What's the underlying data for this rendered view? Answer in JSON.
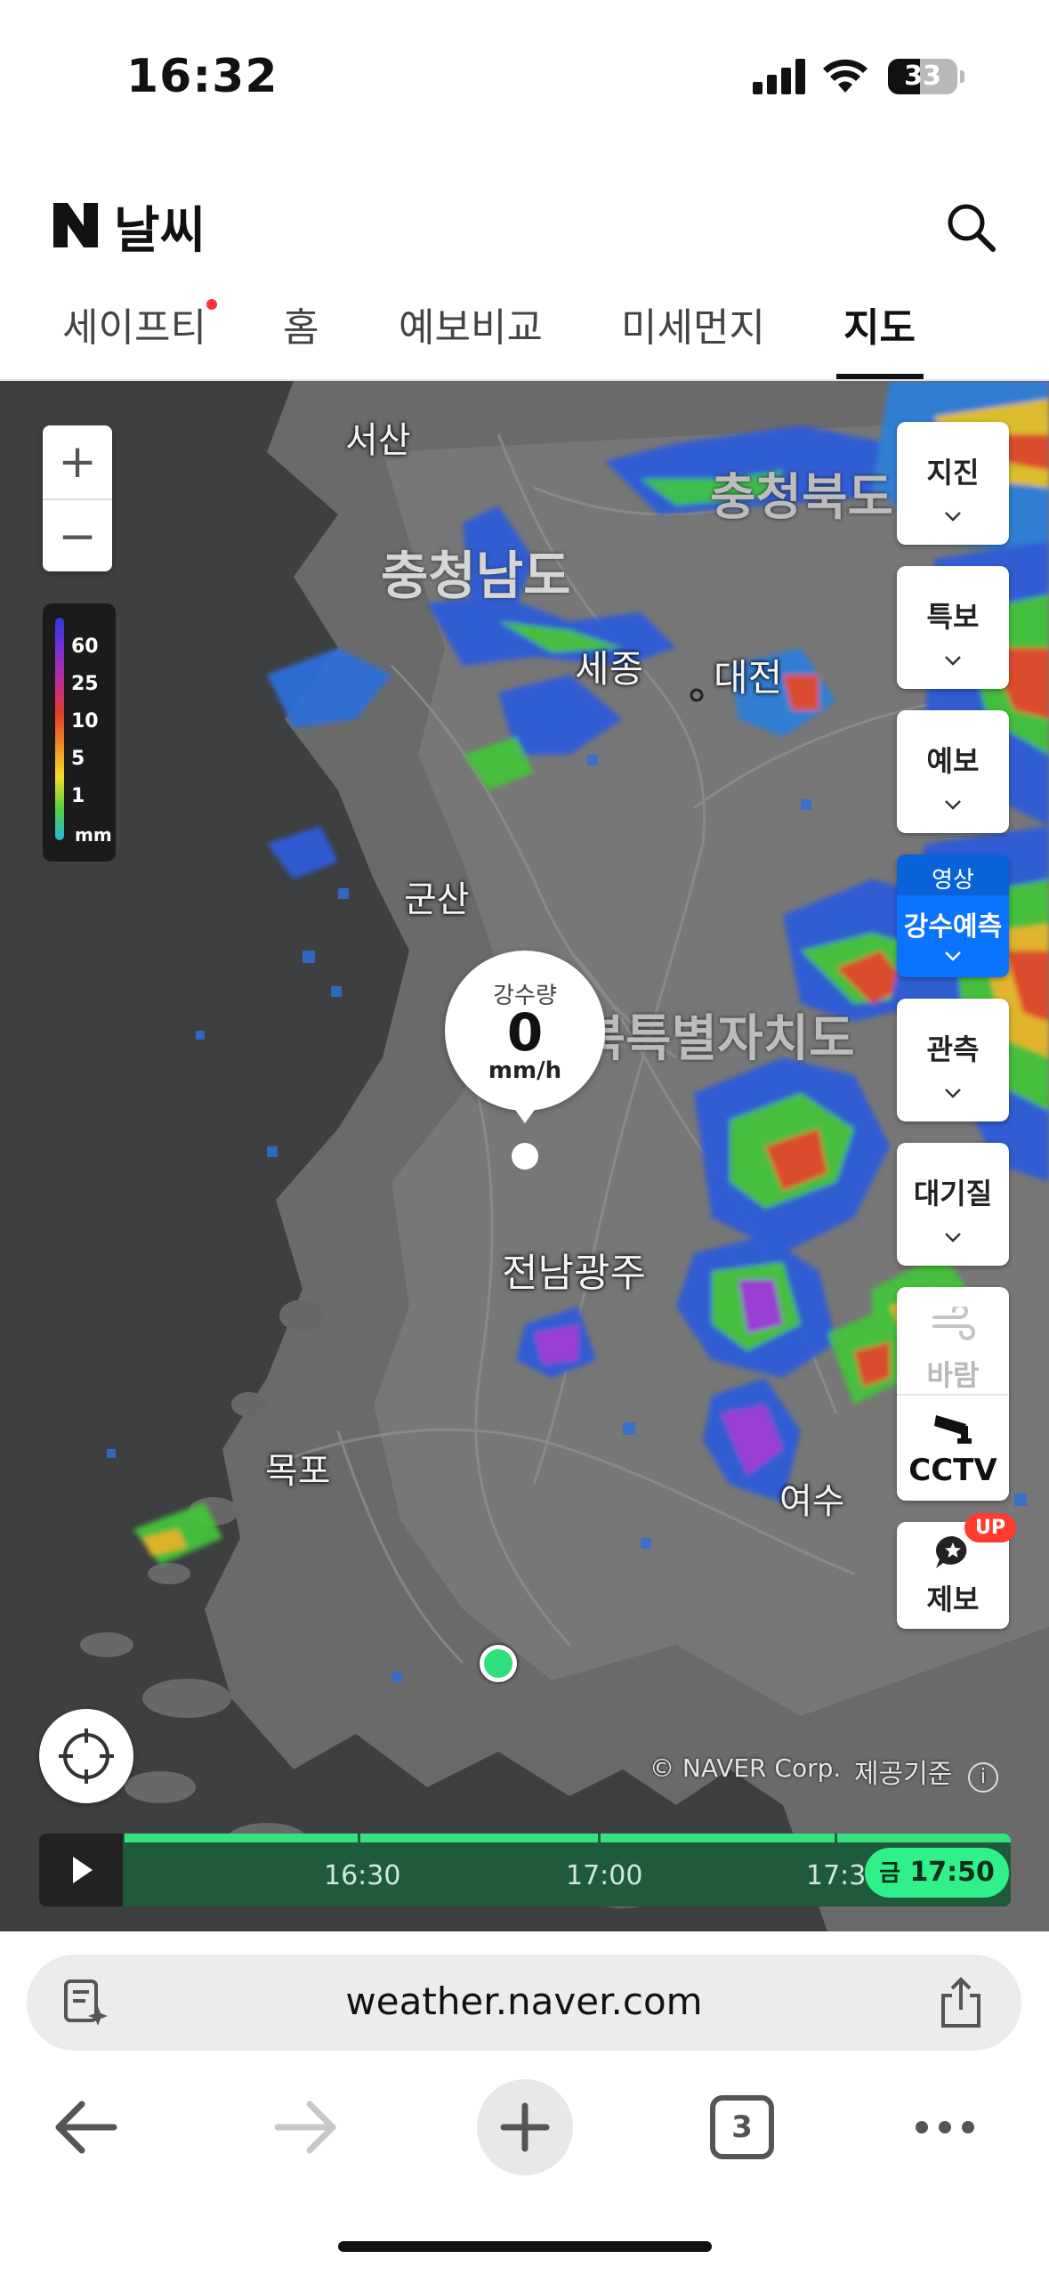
{
  "status_bar": {
    "time": "16:32",
    "battery": "33"
  },
  "header": {
    "brand": "날씨",
    "tabs": [
      {
        "label": "세이프티",
        "badge_dot": true
      },
      {
        "label": "홈"
      },
      {
        "label": "예보비교"
      },
      {
        "label": "미세먼지"
      },
      {
        "label": "지도",
        "active": true
      }
    ]
  },
  "map": {
    "legend": {
      "levels": [
        "60",
        "25",
        "10",
        "5",
        "1"
      ],
      "unit": "mm"
    },
    "labels": {
      "seosan": "서산",
      "chungnam": "충청남도",
      "chungbuk": "충청북도",
      "sejong": "세종",
      "daejeon": "대전",
      "gunsan": "군산",
      "jeonbuk": "전북특별자치도",
      "jeonnam_gwangju": "전남광주",
      "mokpo": "목포",
      "yeosu": "여수"
    },
    "bubble": {
      "title": "강수량",
      "value": "0",
      "unit": "mm/h"
    },
    "right_buttons": {
      "earthquake": "지진",
      "warning": "특보",
      "forecast": "예보",
      "video_sub": "영상",
      "video_label": "강수예측",
      "observation": "관측",
      "air": "대기질",
      "wind": "바람",
      "cctv": "CCTV",
      "report": "제보",
      "report_badge": "UP"
    },
    "credit": "© NAVER Corp.",
    "credit_link": "제공기준",
    "timeline": {
      "ticks": [
        "16:30",
        "17:00",
        "17:3"
      ],
      "current_day": "금",
      "current_time": "17:50"
    }
  },
  "browser": {
    "url": "weather.naver.com",
    "tabs_count": "3"
  },
  "colors": {
    "accent_green": "#2ff08a",
    "accent_blue": "#0a73ff",
    "badge_red": "#ff3b30"
  }
}
